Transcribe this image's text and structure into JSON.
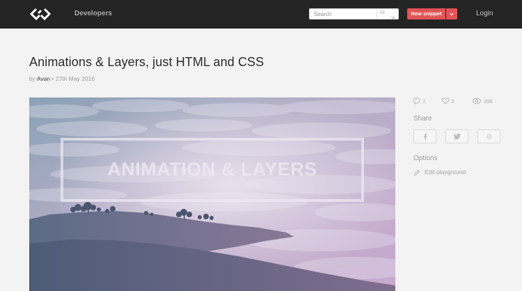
{
  "topbar": {
    "nav_developers": "Developers",
    "search_placeholder": "Search",
    "search_filter": "All",
    "new_snippet_label": "New snippet",
    "login_label": "Login"
  },
  "post": {
    "title": "Animations & Layers, just HTML and CSS",
    "by_label": "by",
    "author": "Avan",
    "date": "• 27th May 2016",
    "hero_text": "ANIMATION & LAYERS"
  },
  "sidebar": {
    "comments_count": "1",
    "likes_count": "3",
    "views_count": "296",
    "share_label": "Share",
    "options_label": "Options",
    "edit_playground_label": "Edit playground"
  },
  "colors": {
    "topbar_bg": "#242424",
    "page_bg": "#f3f3f3",
    "accent_red": "#e25356"
  },
  "icons": [
    "logo-icon",
    "chevron-down-icon",
    "comment-icon",
    "heart-icon",
    "eye-icon",
    "facebook-icon",
    "twitter-icon",
    "google-plus-icon",
    "pencil-icon"
  ]
}
